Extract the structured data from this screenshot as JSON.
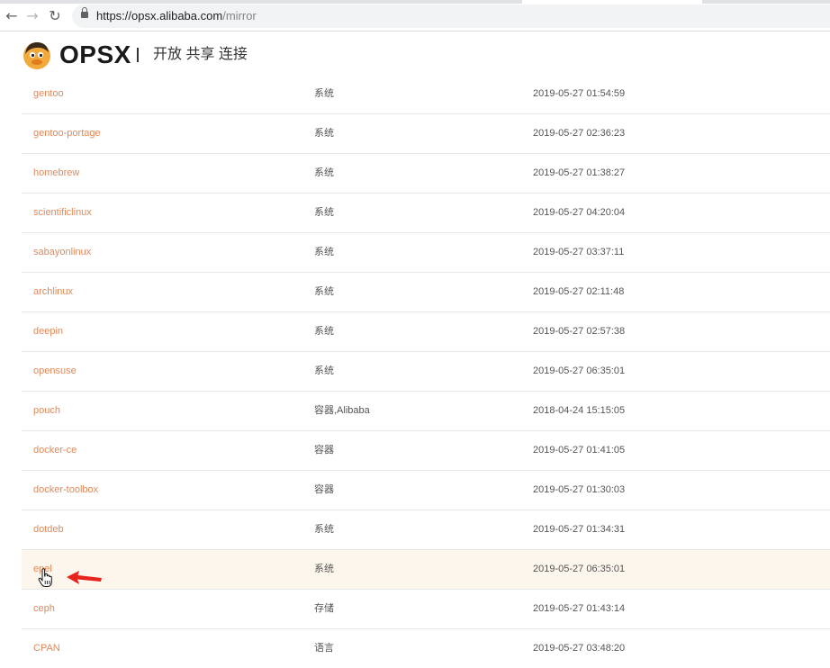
{
  "browser": {
    "url_host": "https://opsx.alibaba.com",
    "url_path": "/mirror",
    "back_glyph": "←",
    "forward_glyph": "→",
    "reload_glyph": "↻"
  },
  "header": {
    "logo_text": "OPSX",
    "slogan": "开放 共享 连接",
    "brand_color": "#e0895a"
  },
  "mirrors": [
    {
      "name": "gentoo",
      "type": "系统",
      "updated": "2019-05-27 01:54:59"
    },
    {
      "name": "gentoo-portage",
      "type": "系统",
      "updated": "2019-05-27 02:36:23"
    },
    {
      "name": "homebrew",
      "type": "系统",
      "updated": "2019-05-27 01:38:27"
    },
    {
      "name": "scientificlinux",
      "type": "系统",
      "updated": "2019-05-27 04:20:04"
    },
    {
      "name": "sabayonlinux",
      "type": "系统",
      "updated": "2019-05-27 03:37:11"
    },
    {
      "name": "archlinux",
      "type": "系统",
      "updated": "2019-05-27 02:11:48"
    },
    {
      "name": "deepin",
      "type": "系统",
      "updated": "2019-05-27 02:57:38"
    },
    {
      "name": "opensuse",
      "type": "系统",
      "updated": "2019-05-27 06:35:01"
    },
    {
      "name": "pouch",
      "type": "容器,Alibaba",
      "updated": "2018-04-24 15:15:05"
    },
    {
      "name": "docker-ce",
      "type": "容器",
      "updated": "2019-05-27 01:41:05"
    },
    {
      "name": "docker-toolbox",
      "type": "容器",
      "updated": "2019-05-27 01:30:03"
    },
    {
      "name": "dotdeb",
      "type": "系统",
      "updated": "2019-05-27 01:34:31"
    },
    {
      "name": "epel",
      "type": "系统",
      "updated": "2019-05-27 06:35:01"
    },
    {
      "name": "ceph",
      "type": "存储",
      "updated": "2019-05-27 01:43:14"
    },
    {
      "name": "CPAN",
      "type": "语言",
      "updated": "2019-05-27 03:48:20"
    }
  ]
}
